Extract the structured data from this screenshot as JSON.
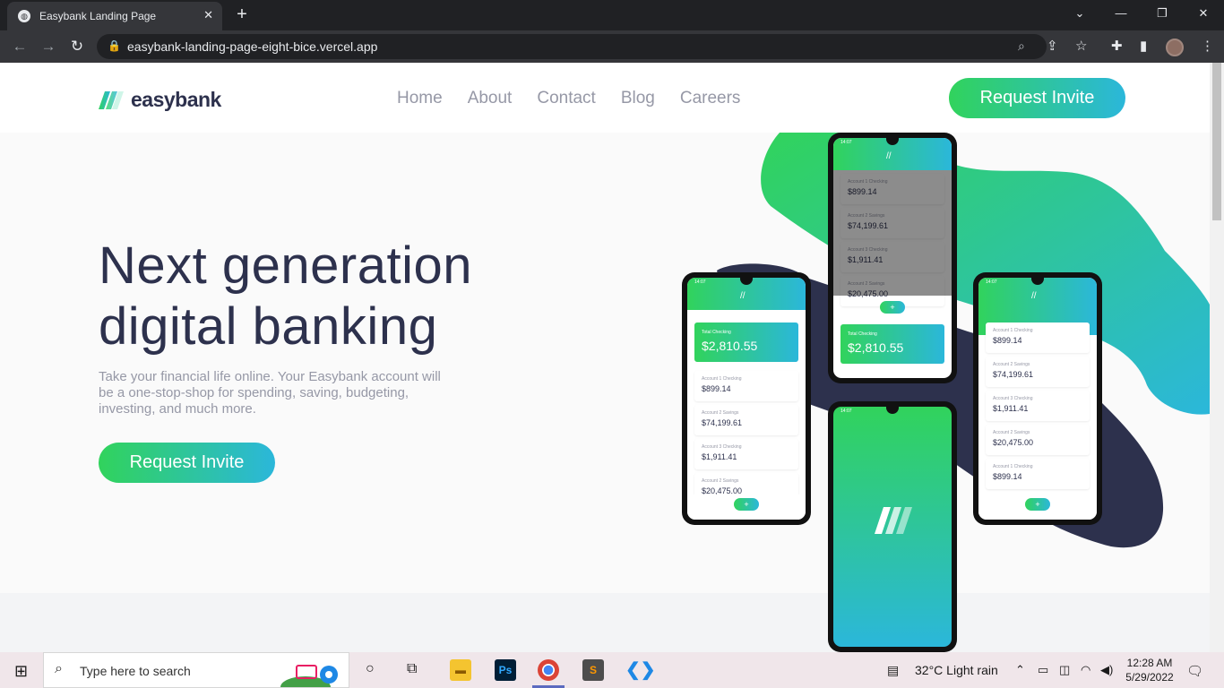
{
  "browser": {
    "tab_title": "Easybank Landing Page",
    "url": "easybank-landing-page-eight-bice.vercel.app"
  },
  "site": {
    "logo_text": "easybank",
    "nav": [
      "Home",
      "About",
      "Contact",
      "Blog",
      "Careers"
    ],
    "cta_header": "Request Invite",
    "hero": {
      "title_line1": "Next generation",
      "title_line2": "digital banking",
      "description": "Take your financial life online. Your Easybank account will be a one-stop-shop for spending, saving, budgeting, investing, and much more.",
      "cta": "Request Invite"
    },
    "mockup": {
      "time": "14:07",
      "total_label": "Total Checking",
      "total_amount": "$2,810.55",
      "accounts": [
        {
          "label": "Account 1 Checking",
          "amount": "$899.14"
        },
        {
          "label": "Account 2 Savings",
          "amount": "$74,199.61"
        },
        {
          "label": "Account 3 Checking",
          "amount": "$1,911.41"
        },
        {
          "label": "Account 2 Savings",
          "amount": "$20,475.00"
        }
      ]
    }
  },
  "taskbar": {
    "search_placeholder": "Type here to search",
    "weather": "32°C  Light rain",
    "time": "12:28 AM",
    "date": "5/29/2022"
  },
  "colors": {
    "brand_green": "#31d35c",
    "brand_cyan": "#2bb7da",
    "dark_blue": "#2d314d",
    "grayish_blue": "#9698a6"
  }
}
